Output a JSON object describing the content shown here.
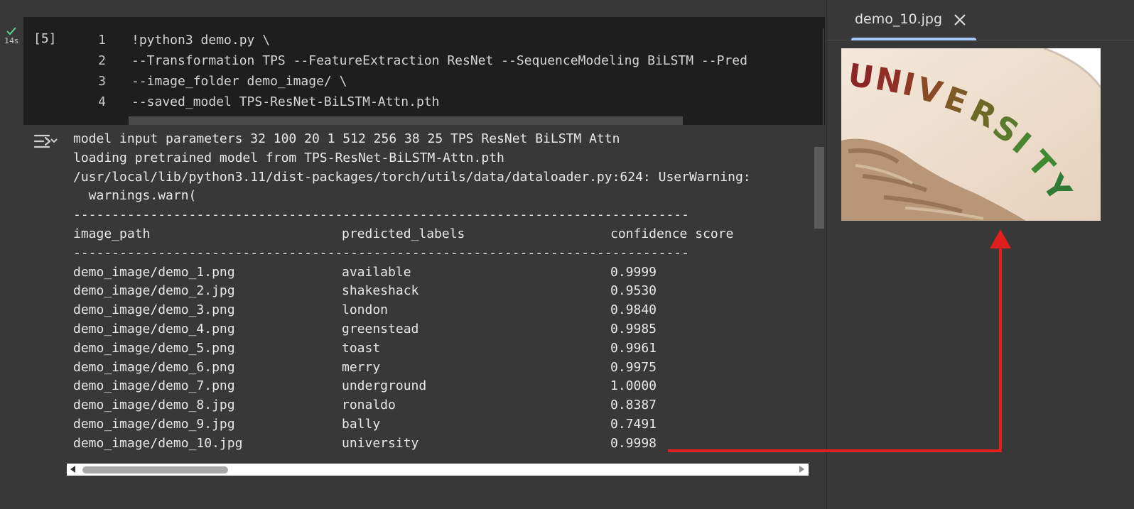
{
  "cell": {
    "exec_count": "[5]",
    "exec_time": "14s",
    "lines": [
      {
        "num": "1",
        "code": "!python3 demo.py \\"
      },
      {
        "num": "2",
        "code": "--Transformation TPS --FeatureExtraction ResNet --SequenceModeling BiLSTM --Pred"
      },
      {
        "num": "3",
        "code": "--image_folder demo_image/ \\"
      },
      {
        "num": "4",
        "code": "--saved_model TPS-ResNet-BiLSTM-Attn.pth"
      }
    ]
  },
  "output": {
    "log_lines": [
      "model input parameters 32 100 20 1 512 256 38 25 TPS ResNet BiLSTM Attn",
      "loading pretrained model from TPS-ResNet-BiLSTM-Attn.pth",
      "/usr/local/lib/python3.11/dist-packages/torch/utils/data/dataloader.py:624: UserWarning:",
      "  warnings.warn("
    ],
    "separator": "--------------------------------------------------------------------------------",
    "headers": [
      "image_path",
      "predicted_labels",
      "confidence score"
    ],
    "rows": [
      [
        "demo_image/demo_1.png",
        "available",
        "0.9999"
      ],
      [
        "demo_image/demo_2.jpg",
        "shakeshack",
        "0.9530"
      ],
      [
        "demo_image/demo_3.png",
        "london",
        "0.9840"
      ],
      [
        "demo_image/demo_4.png",
        "greenstead",
        "0.9985"
      ],
      [
        "demo_image/demo_5.png",
        "toast",
        "0.9961"
      ],
      [
        "demo_image/demo_6.png",
        "merry",
        "0.9975"
      ],
      [
        "demo_image/demo_7.png",
        "underground",
        "1.0000"
      ],
      [
        "demo_image/demo_8.jpg",
        "ronaldo",
        "0.8387"
      ],
      [
        "demo_image/demo_9.jpg",
        "bally",
        "0.7491"
      ],
      [
        "demo_image/demo_10.jpg",
        "university",
        "0.9998"
      ]
    ]
  },
  "panel": {
    "tab_label": "demo_10.jpg",
    "close_icon": "close-icon",
    "image_text": "UNIVERSITY",
    "image_letters": [
      "U",
      "N",
      "I",
      "V",
      "E",
      "R",
      "S",
      "I",
      "T",
      "Y"
    ]
  },
  "colors": {
    "accent": "#a8c7fa",
    "success": "#5fd38d",
    "annotation": "#e02020"
  }
}
